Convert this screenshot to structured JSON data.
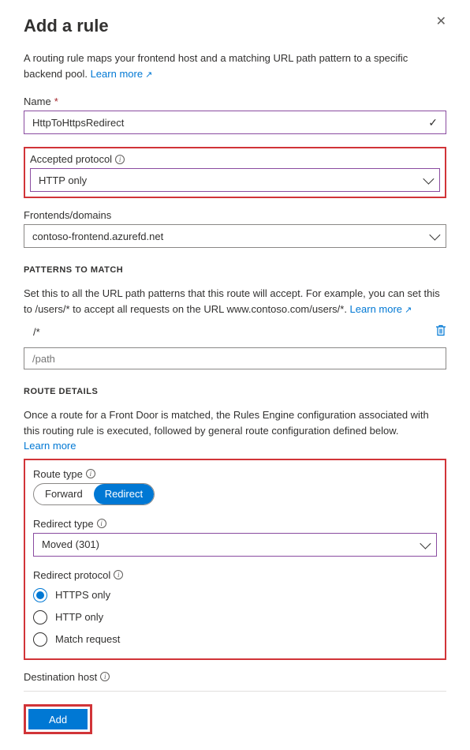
{
  "header": {
    "title": "Add a rule"
  },
  "intro": {
    "text": "A routing rule maps your frontend host and a matching URL path pattern to a specific backend pool. ",
    "learn_more": "Learn more"
  },
  "name_field": {
    "label": "Name",
    "value": "HttpToHttpsRedirect"
  },
  "protocol_field": {
    "label": "Accepted protocol",
    "value": "HTTP only"
  },
  "frontends_field": {
    "label": "Frontends/domains",
    "value": "contoso-frontend.azurefd.net"
  },
  "patterns": {
    "section_title": "PATTERNS TO MATCH",
    "desc_prefix": "Set this to all the URL path patterns that this route will accept. For example, you can set this to /users/* to accept all requests on the URL www.contoso.com/users/*. ",
    "learn_more": "Learn more",
    "item": "/*",
    "input_placeholder": "/path"
  },
  "route_details": {
    "section_title": "ROUTE DETAILS",
    "desc": "Once a route for a Front Door is matched, the Rules Engine configuration associated with this routing rule is executed, followed by general route configuration defined below.",
    "learn_more": "Learn more",
    "route_type_label": "Route type",
    "route_type_forward": "Forward",
    "route_type_redirect": "Redirect",
    "redirect_type_label": "Redirect type",
    "redirect_type_value": "Moved (301)",
    "redirect_protocol_label": "Redirect protocol",
    "proto_https": "HTTPS only",
    "proto_http": "HTTP only",
    "proto_match": "Match request",
    "dest_host_label": "Destination host"
  },
  "footer": {
    "add": "Add"
  }
}
